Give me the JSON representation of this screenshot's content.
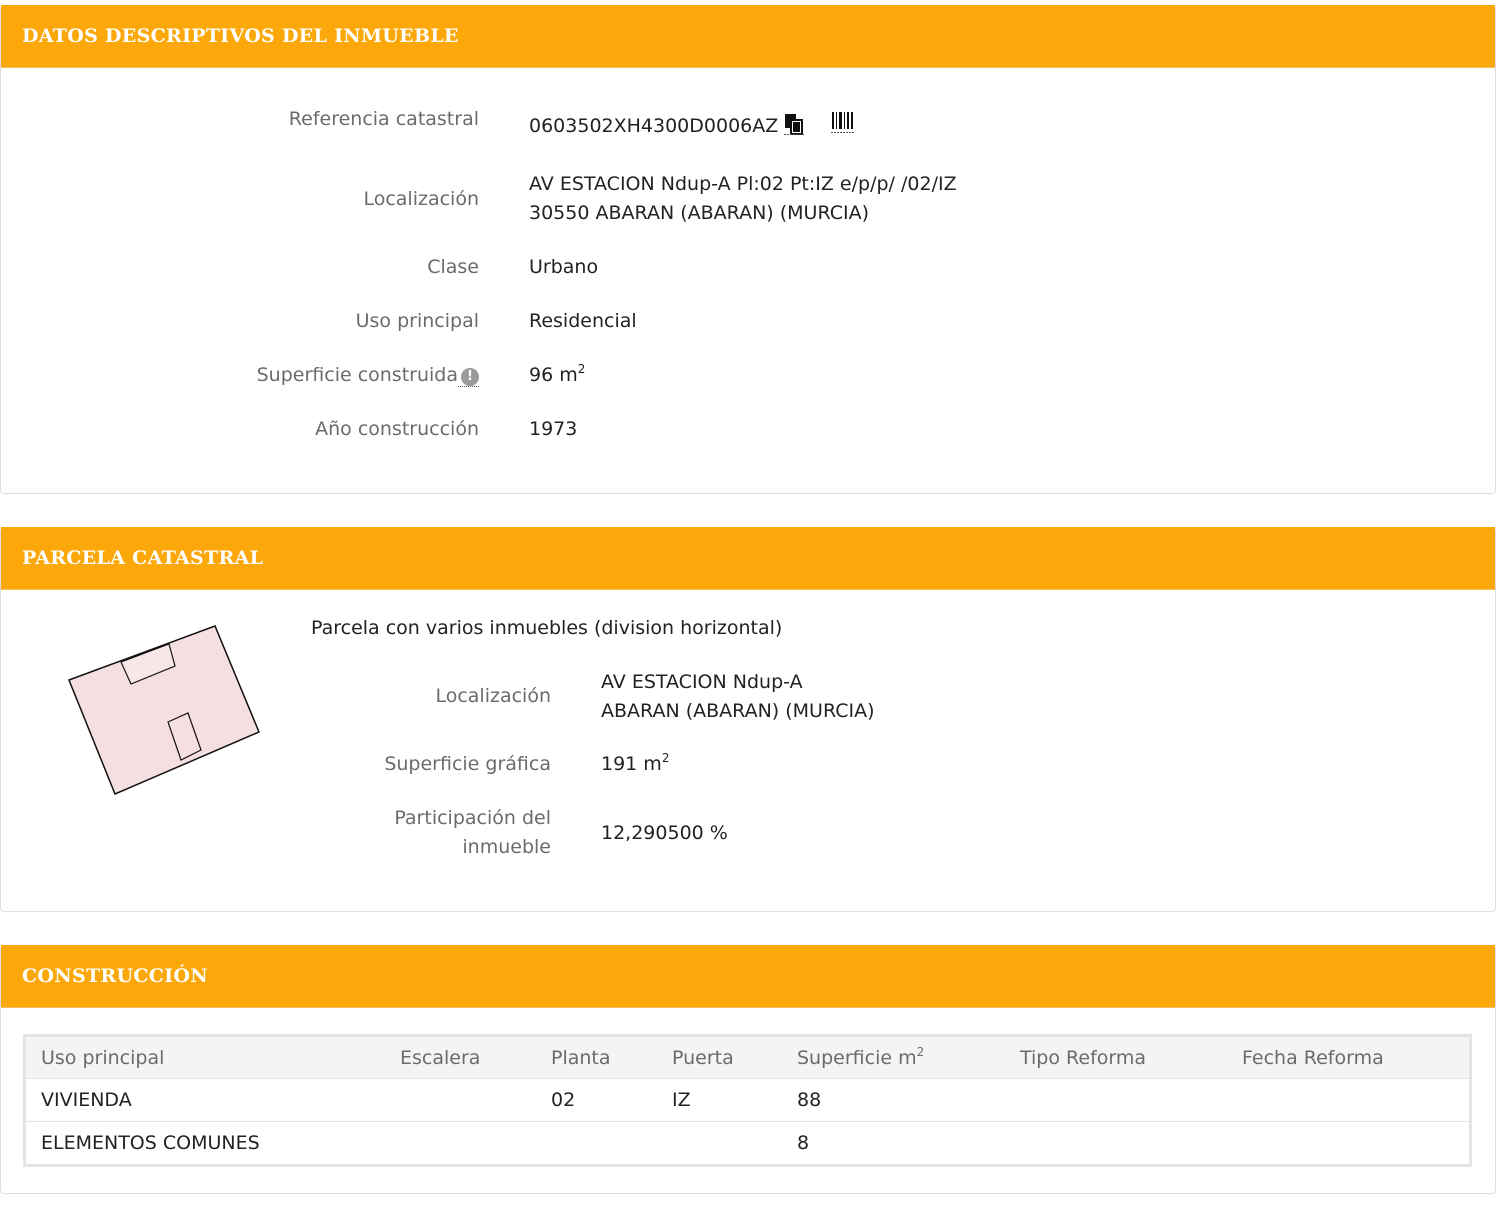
{
  "section1": {
    "title": "DATOS DESCRIPTIVOS DEL INMUEBLE",
    "ref_label": "Referencia catastral",
    "ref_value": "0603502XH4300D0006AZ",
    "loc_label": "Localización",
    "loc_line1": "AV ESTACION Ndup-A Pl:02 Pt:IZ e/p/p/ /02/IZ",
    "loc_line2": "30550 ABARAN (ABARAN) (MURCIA)",
    "clase_label": "Clase",
    "clase_value": "Urbano",
    "uso_label": "Uso principal",
    "uso_value": "Residencial",
    "sup_label": "Superficie construida",
    "sup_value": "96 m",
    "sup_unit_exp": "2",
    "info_icon_glyph": "!",
    "anio_label": "Año construcción",
    "anio_value": "1973"
  },
  "section2": {
    "title": "PARCELA CATASTRAL",
    "description": "Parcela con varios inmuebles (division horizontal)",
    "loc_label": "Localización",
    "loc_line1": "AV ESTACION Ndup-A",
    "loc_line2": "ABARAN (ABARAN) (MURCIA)",
    "sup_label": "Superficie gráfica",
    "sup_value": "191 m",
    "sup_unit_exp": "2",
    "part_label_line1": "Participación del",
    "part_label_line2": "inmueble",
    "part_value": "12,290500 %"
  },
  "section3": {
    "title": "CONSTRUCCIÓN",
    "headers": [
      "Uso principal",
      "Escalera",
      "Planta",
      "Puerta",
      "Superficie m",
      "Tipo Reforma",
      "Fecha Reforma"
    ],
    "superficie_exp": "2",
    "rows": [
      [
        "VIVIENDA",
        "",
        "02",
        "IZ",
        "88",
        "",
        ""
      ],
      [
        "ELEMENTOS COMUNES",
        "",
        "",
        "",
        "8",
        "",
        ""
      ]
    ]
  },
  "colors": {
    "header_orange": "#fca80b",
    "parcel_fill": "#f6dfe1"
  }
}
